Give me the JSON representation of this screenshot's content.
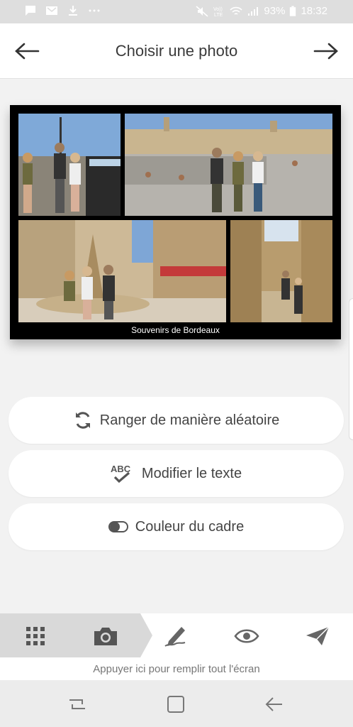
{
  "status_bar": {
    "battery": "93%",
    "time": "18:32",
    "icons": [
      "chat-icon",
      "mail-icon",
      "download-icon",
      "more-icon",
      "mute-icon",
      "volte-icon",
      "wifi-icon",
      "signal-icon",
      "battery-icon"
    ]
  },
  "header": {
    "title": "Choisir une photo",
    "back_icon": "arrow-left-icon",
    "forward_icon": "arrow-right-icon"
  },
  "collage": {
    "caption": "Souvenirs de Bordeaux",
    "frame_color": "#000000",
    "photos": [
      "photo-1",
      "photo-2",
      "photo-3",
      "photo-4"
    ]
  },
  "actions": [
    {
      "label": "Ranger de manière aléatoire",
      "icon": "shuffle-icon"
    },
    {
      "label": "Modifier le texte",
      "icon": "spellcheck-icon"
    },
    {
      "label": "Couleur du cadre",
      "icon": "toggle-icon"
    }
  ],
  "toolbar": {
    "items": [
      "grid-icon",
      "camera-icon",
      "pen-icon",
      "eye-icon",
      "send-icon"
    ],
    "active_index": 1,
    "hint": "Appuyer ici pour remplir tout l'écran"
  },
  "colors": {
    "accent_active": "#d9d9d9",
    "icon": "#555555"
  }
}
